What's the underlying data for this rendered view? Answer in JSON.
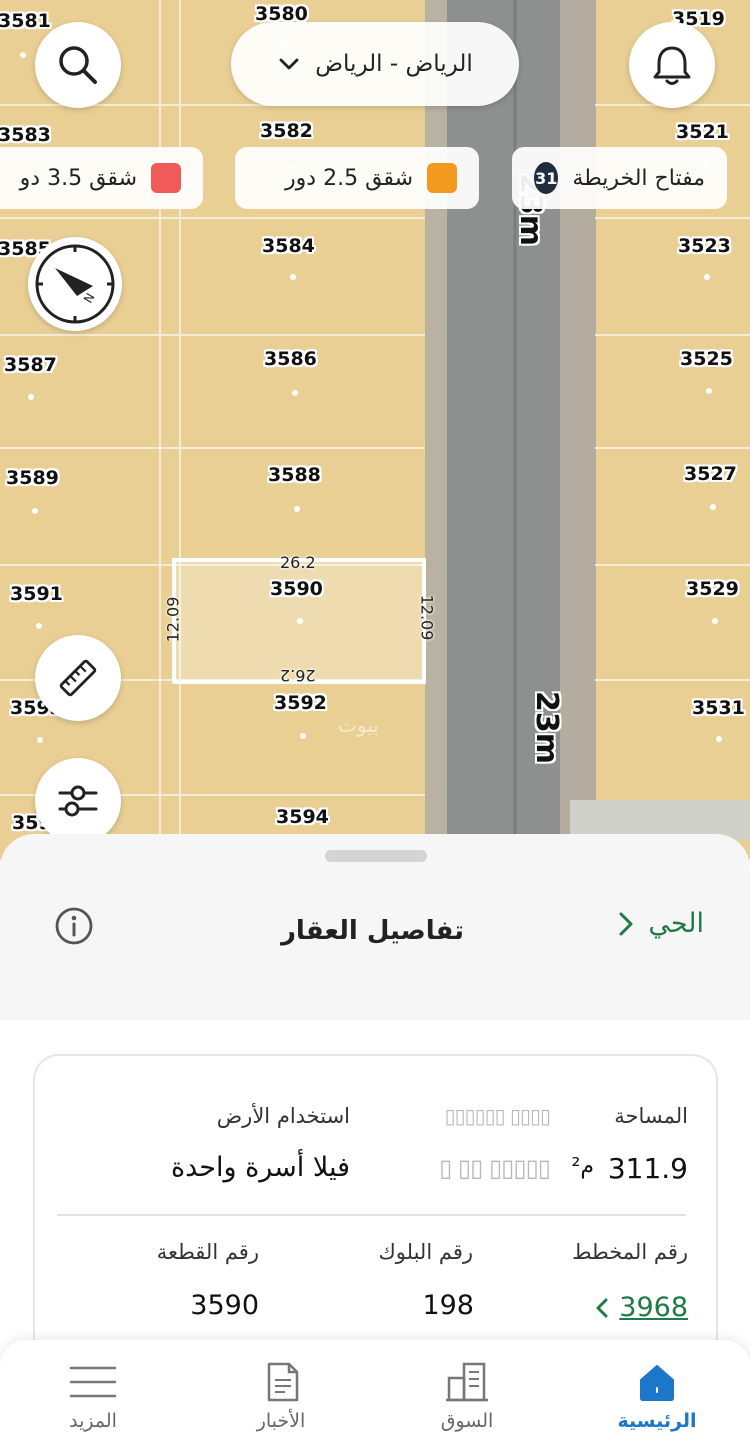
{
  "search": {
    "icon": "search-icon"
  },
  "notifications": {
    "icon": "bell-icon"
  },
  "city_selector": {
    "label": "الرياض - الرياض",
    "icon": "chevron-down-icon"
  },
  "legend": {
    "map_key_label": "مفتاح الخريطة",
    "map_key_count": "31",
    "chips": [
      {
        "label": "شقق 2.5 دور",
        "color": "#f39a1e"
      },
      {
        "label": "شقق 3.5 دو",
        "color": "#f05a5a"
      }
    ]
  },
  "map": {
    "parcels_left": [
      "3581",
      "3583",
      "3585",
      "3587",
      "3589",
      "3591",
      "3593",
      "3595"
    ],
    "parcels_middle": [
      "3580",
      "3582",
      "3584",
      "3586",
      "3588",
      "3590",
      "3592",
      "3594"
    ],
    "parcels_right": [
      "3519",
      "3521",
      "3523",
      "3525",
      "3527",
      "3529",
      "3531"
    ],
    "street_width": "23m",
    "selected": {
      "number": "3590",
      "length_top": "26.2",
      "length_bottom": "26.2",
      "width_left": "12.09",
      "width_right": "12.09"
    },
    "watermark": "بيوت"
  },
  "sheet": {
    "title": "تفاصيل العقار",
    "neighborhood_link": "الحي",
    "fields": {
      "area_label": "المساحة",
      "area_value": "311.9",
      "area_unit": "م²",
      "land_use_label": "استخدام الأرض",
      "land_use_value": "فيلا أسرة واحدة",
      "plan_label": "رقم المخطط",
      "plan_value": "3968",
      "block_label": "رقم البلوك",
      "block_value": "198",
      "plot_label": "رقم القطعة",
      "plot_value": "3590"
    }
  },
  "bottom_nav": [
    {
      "label": "الرئيسية",
      "icon": "home-icon",
      "active": true
    },
    {
      "label": "السوق",
      "icon": "buildings-icon",
      "active": false
    },
    {
      "label": "الأخبار",
      "icon": "news-icon",
      "active": false
    },
    {
      "label": "المزيد",
      "icon": "menu-icon",
      "active": false
    }
  ]
}
